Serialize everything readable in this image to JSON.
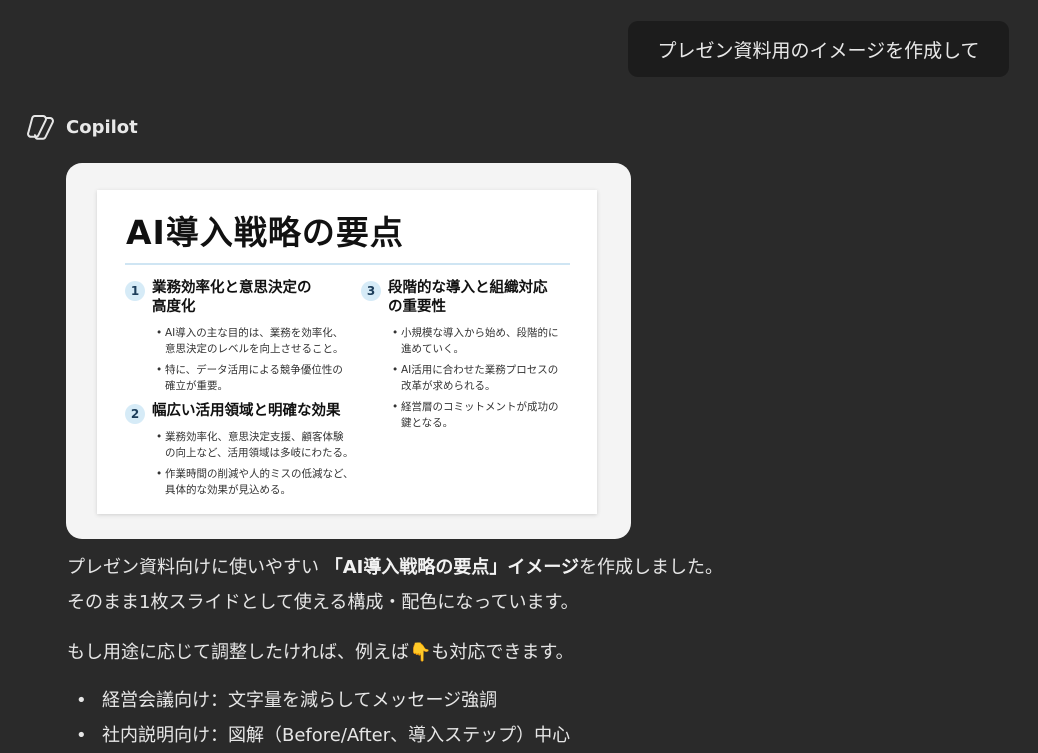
{
  "user_message": "プレゼン資料用のイメージを作成して",
  "assistant_name": "Copilot",
  "slide": {
    "title": "AI導入戦略の要点",
    "sections": [
      {
        "number": "1",
        "heading": "業務効率化と意思決定の\n高度化",
        "bullets": [
          "AI導入の主な目的は、業務を効率化、\n意思決定のレベルを向上させること。",
          "特に、データ活用による競争優位性の\n確立が重要。"
        ]
      },
      {
        "number": "2",
        "heading": "幅広い活用領域と明確な効果",
        "bullets": [
          "業務効率化、意思決定支援、顧客体験\nの向上など、活用領域は多岐にわたる。",
          "作業時間の削減や人的ミスの低減など、\n具体的な効果が見込める。"
        ]
      },
      {
        "number": "3",
        "heading": "段階的な導入と組織対応\nの重要性",
        "bullets": [
          "小規模な導入から始め、段階的に\n進めていく。",
          "AI活用に合わせた業務プロセスの\n改革が求められる。",
          "経営層のコミットメントが成功の\n鍵となる。"
        ]
      }
    ]
  },
  "response": {
    "line1_pre": "プレゼン資料向けに使いやすい ",
    "line1_bold": "「AI導入戦略の要点」イメージ",
    "line1_post": "を作成しました。",
    "line2": "そのまま1枚スライドとして使える構成・配色になっています。",
    "line3_pre": "もし用途に応じて調整したければ、例えば",
    "line3_emoji": "👇",
    "line3_post": "も対応できます。",
    "bullets": [
      "経営会議向け：文字量を減らしてメッセージ強調",
      "社内説明向け：図解（Before/After、導入ステップ）中心"
    ]
  }
}
